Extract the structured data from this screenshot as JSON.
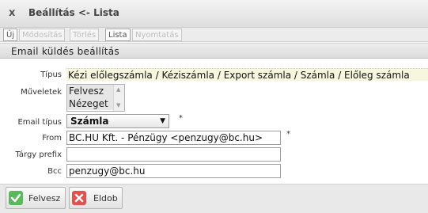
{
  "window": {
    "close_glyph": "x",
    "title": "Beállítás <- Lista"
  },
  "toolbar": {
    "tabs": [
      {
        "label": "Új",
        "enabled": true
      },
      {
        "label": "Módosítás",
        "enabled": false
      },
      {
        "label": "Törlés",
        "enabled": false
      },
      {
        "label": "Lista",
        "enabled": true
      },
      {
        "label": "Nyomtatás",
        "enabled": false
      }
    ]
  },
  "section": {
    "title": "Email küldés beállítás"
  },
  "form": {
    "type_label": "Típus",
    "type_value": "Kézi előlegszámla / Kéziszámla / Export számla / Számla / Előleg számla",
    "operations_label": "Műveletek",
    "operations_options": [
      "Felvesz",
      "Nézeget"
    ],
    "email_type_label": "Email típus",
    "email_type_value": "Számla",
    "from_label": "From",
    "from_value": "BC.HU Kft. - Pénzügy <penzugy@bc.hu>",
    "subject_prefix_label": "Tárgy prefix",
    "subject_prefix_value": "",
    "bcc_label": "Bcc",
    "bcc_value": "penzugy@bc.hu",
    "required_mark": "*"
  },
  "actions": {
    "add_label": "Felvesz",
    "discard_label": "Eldob",
    "add_icon": "check-icon",
    "discard_icon": "discard-icon",
    "add_icon_color": "#5cb85c",
    "discard_icon_color": "#e0524f"
  }
}
